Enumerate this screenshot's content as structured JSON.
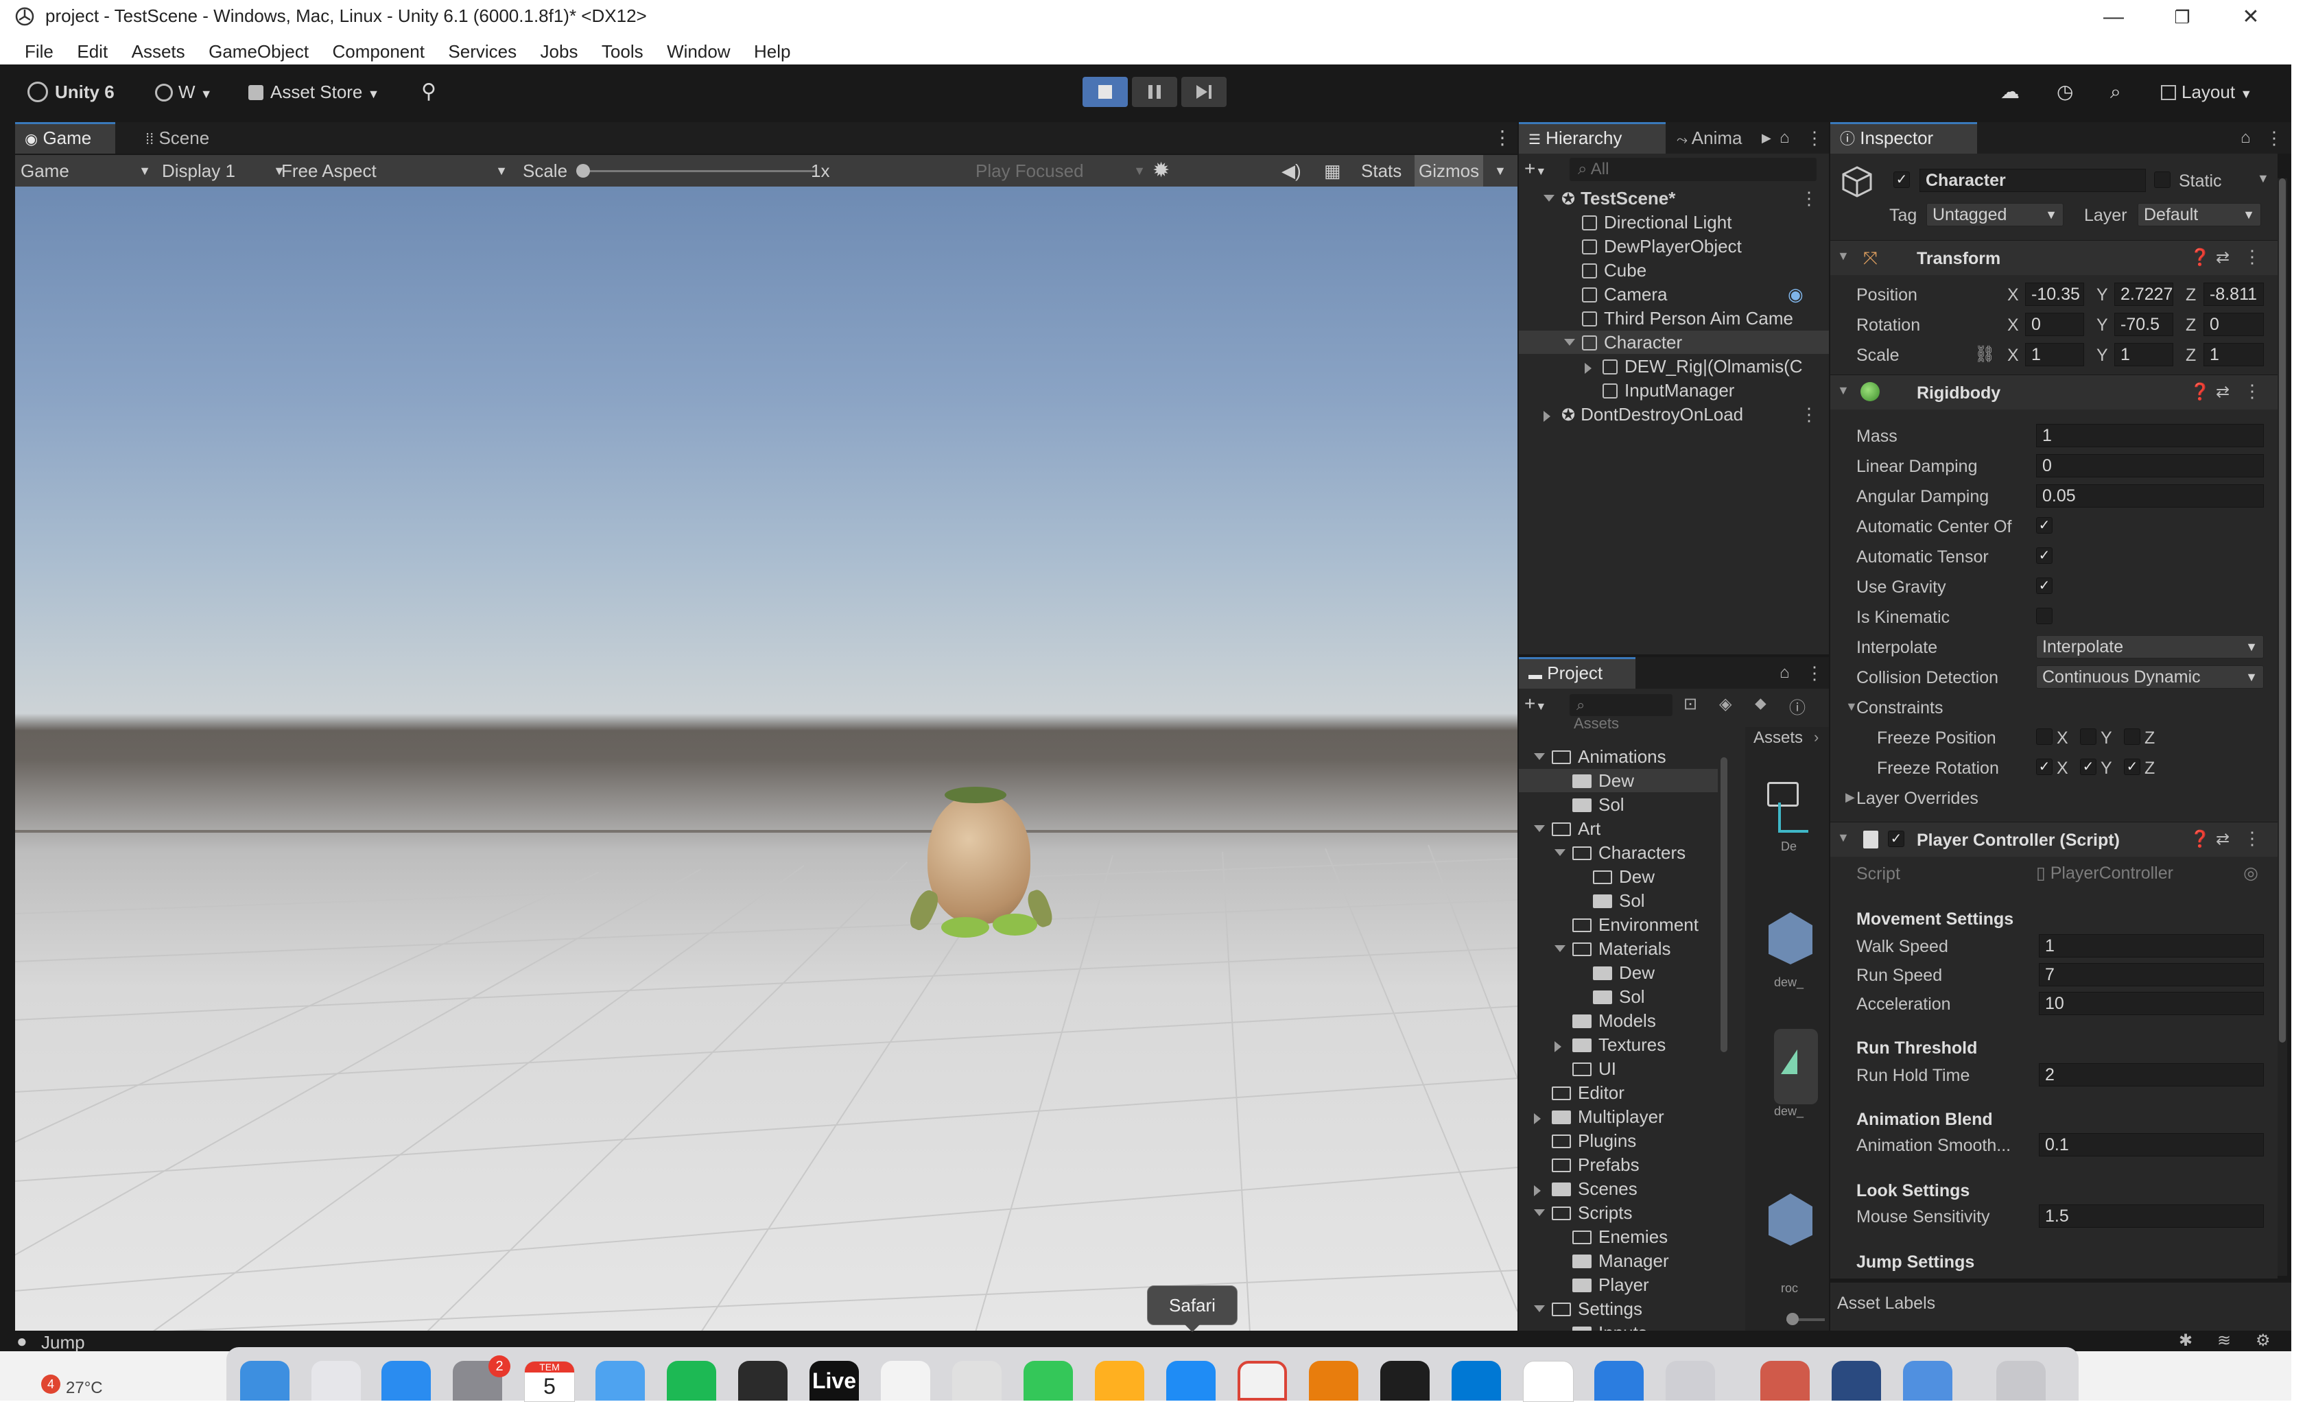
{
  "window": {
    "title": "project - TestScene - Windows, Mac, Linux - Unity 6.1 (6000.1.8f1)* <DX12>",
    "minimize": "—",
    "maximize": "❐",
    "close": "✕"
  },
  "menu": [
    "File",
    "Edit",
    "Assets",
    "GameObject",
    "Component",
    "Services",
    "Jobs",
    "Tools",
    "Window",
    "Help"
  ],
  "toolbar": {
    "unity_label": "Unity 6",
    "account_label": "W",
    "asset_store_label": "Asset Store",
    "layout_label": "Layout"
  },
  "game": {
    "tabs": [
      "Game",
      "Scene"
    ],
    "view_dropdown": "Game",
    "display_dropdown": "Display 1",
    "aspect_dropdown": "Free Aspect",
    "scale_label": "Scale",
    "scale_value": "1x",
    "play_mode_dropdown": "Play Focused",
    "stats_label": "Stats",
    "gizmos_label": "Gizmos"
  },
  "hierarchy": {
    "tabs": [
      "Hierarchy",
      "Anima"
    ],
    "search_placeholder": "All",
    "items": [
      {
        "label": "TestScene*",
        "depth": 0,
        "kind": "scene",
        "expanded": true
      },
      {
        "label": "Directional Light",
        "depth": 1,
        "kind": "object"
      },
      {
        "label": "DewPlayerObject",
        "depth": 1,
        "kind": "object"
      },
      {
        "label": "Cube",
        "depth": 1,
        "kind": "object"
      },
      {
        "label": "Camera",
        "depth": 1,
        "kind": "object"
      },
      {
        "label": "Third Person Aim Came",
        "depth": 1,
        "kind": "object"
      },
      {
        "label": "Character",
        "depth": 1,
        "kind": "object",
        "expanded": true,
        "selected": true
      },
      {
        "label": "DEW_Rig|(Olmamis(C",
        "depth": 2,
        "kind": "object",
        "collapsed": true
      },
      {
        "label": "InputManager",
        "depth": 2,
        "kind": "object"
      },
      {
        "label": "DontDestroyOnLoad",
        "depth": 0,
        "kind": "scene",
        "collapsed": true
      }
    ]
  },
  "project": {
    "tab": "Project",
    "breadcrumb": "Assets",
    "root_label": "Assets",
    "tree": [
      {
        "label": "Animations",
        "depth": 1,
        "open": true
      },
      {
        "label": "Dew",
        "depth": 2,
        "selected": true
      },
      {
        "label": "Sol",
        "depth": 2
      },
      {
        "label": "Art",
        "depth": 1,
        "open": true
      },
      {
        "label": "Characters",
        "depth": 2,
        "open": true
      },
      {
        "label": "Dew",
        "depth": 3,
        "empty": true
      },
      {
        "label": "Sol",
        "depth": 3
      },
      {
        "label": "Environment",
        "depth": 2,
        "empty": true
      },
      {
        "label": "Materials",
        "depth": 2,
        "open": true
      },
      {
        "label": "Dew",
        "depth": 3
      },
      {
        "label": "Sol",
        "depth": 3
      },
      {
        "label": "Models",
        "depth": 2
      },
      {
        "label": "Textures",
        "depth": 2,
        "collapsed": true
      },
      {
        "label": "UI",
        "depth": 2,
        "empty": true
      },
      {
        "label": "Editor",
        "depth": 1,
        "empty": true
      },
      {
        "label": "Multiplayer",
        "depth": 1,
        "collapsed": true
      },
      {
        "label": "Plugins",
        "depth": 1,
        "empty": true
      },
      {
        "label": "Prefabs",
        "depth": 1,
        "empty": true
      },
      {
        "label": "Scenes",
        "depth": 1,
        "collapsed": true
      },
      {
        "label": "Scripts",
        "depth": 1,
        "open": true
      },
      {
        "label": "Enemies",
        "depth": 2,
        "empty": true
      },
      {
        "label": "Manager",
        "depth": 2
      },
      {
        "label": "Player",
        "depth": 2
      },
      {
        "label": "Settings",
        "depth": 1,
        "open": true
      },
      {
        "label": "Inputs",
        "depth": 2
      }
    ],
    "grid_labels": [
      "De",
      "dew_",
      "dew_",
      "roc"
    ]
  },
  "inspector": {
    "tab": "Inspector",
    "object_name": "Character",
    "static_label": "Static",
    "tag_label": "Tag",
    "tag_value": "Untagged",
    "layer_label": "Layer",
    "layer_value": "Default",
    "transform": {
      "title": "Transform",
      "position_label": "Position",
      "rotation_label": "Rotation",
      "scale_label": "Scale",
      "position": {
        "x": "-10.35",
        "y": "2.7227",
        "z": "-8.811"
      },
      "rotation": {
        "x": "0",
        "y": "-70.5",
        "z": "0"
      },
      "scale": {
        "x": "1",
        "y": "1",
        "z": "1"
      }
    },
    "rigidbody": {
      "title": "Rigidbody",
      "mass_label": "Mass",
      "mass": "1",
      "linear_damping_label": "Linear Damping",
      "linear_damping": "0",
      "angular_damping_label": "Angular Damping",
      "angular_damping": "0.05",
      "auto_center_label": "Automatic Center Of",
      "auto_center": true,
      "auto_tensor_label": "Automatic Tensor",
      "auto_tensor": true,
      "use_gravity_label": "Use Gravity",
      "use_gravity": true,
      "is_kinematic_label": "Is Kinematic",
      "is_kinematic": false,
      "interpolate_label": "Interpolate",
      "interpolate": "Interpolate",
      "collision_label": "Collision Detection",
      "collision": "Continuous Dynamic",
      "constraints_label": "Constraints",
      "freeze_position_label": "Freeze Position",
      "freeze_rotation_label": "Freeze Rotation",
      "freeze_position": {
        "x": false,
        "y": false,
        "z": false
      },
      "freeze_rotation": {
        "x": true,
        "y": true,
        "z": true
      },
      "layer_overrides_label": "Layer Overrides"
    },
    "player_controller": {
      "title": "Player Controller (Script)",
      "script_label": "Script",
      "script_value": "PlayerController",
      "movement_header": "Movement Settings",
      "walk_speed_label": "Walk Speed",
      "walk_speed": "1",
      "run_speed_label": "Run Speed",
      "run_speed": "7",
      "acceleration_label": "Acceleration",
      "acceleration": "10",
      "run_threshold_header": "Run Threshold",
      "run_hold_label": "Run Hold Time",
      "run_hold": "2",
      "anim_blend_header": "Animation Blend",
      "anim_smooth_label": "Animation Smooth...",
      "anim_smooth": "0.1",
      "look_header": "Look Settings",
      "mouse_sens_label": "Mouse Sensitivity",
      "mouse_sens": "1.5",
      "jump_header": "Jump Settings"
    },
    "asset_labels": "Asset Labels"
  },
  "status": {
    "message": "Jump"
  },
  "taskbar": {
    "weather": "27°C",
    "weather_badge": "4",
    "tooltip": "Safari",
    "calendar_month": "TEM",
    "calendar_day": "5",
    "settings_badge": "2",
    "live_label": "Live"
  }
}
